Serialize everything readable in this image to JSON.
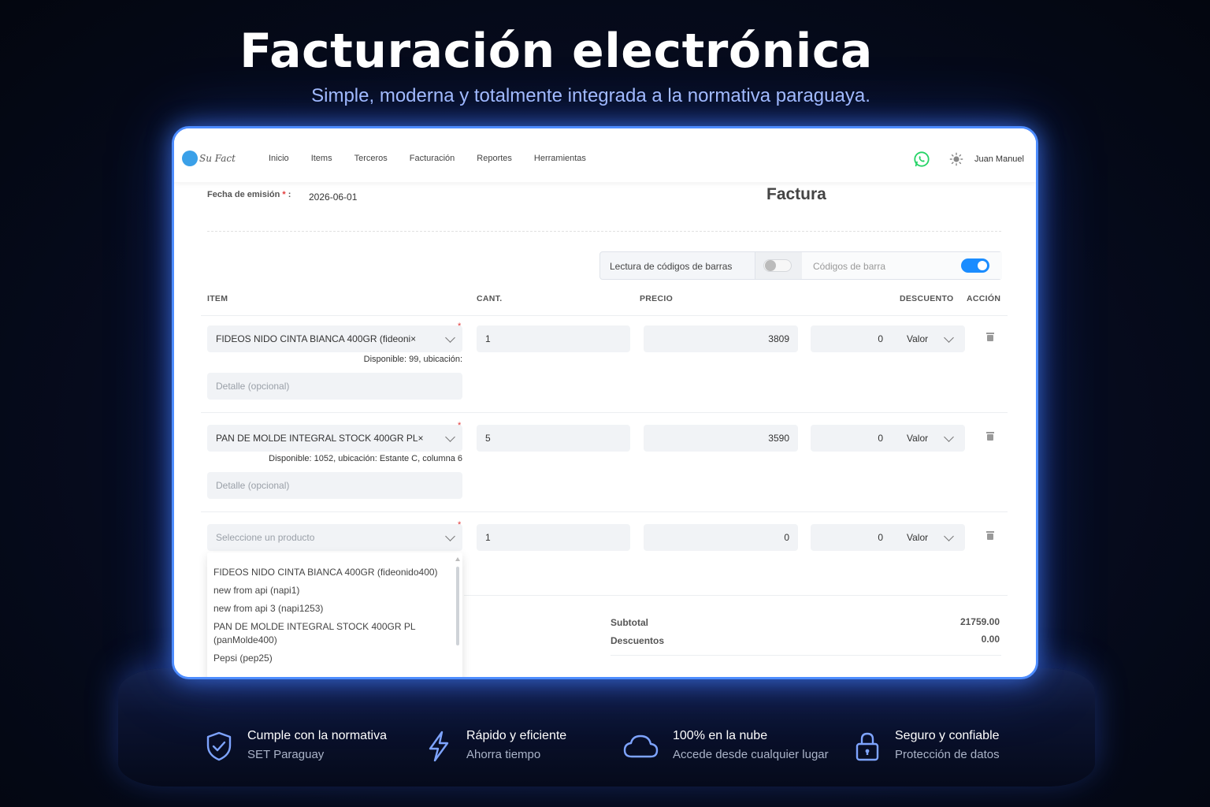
{
  "hero": {
    "title": "Facturación electrónica",
    "subtitle": "Simple, moderna y totalmente integrada a la normativa paraguaya."
  },
  "app": {
    "logo_text": "Su Fact",
    "nav": [
      "Inicio",
      "Items",
      "Terceros",
      "Facturación",
      "Reportes",
      "Herramientas"
    ],
    "user_name": "Juan Manuel",
    "fecha_label": "Fecha de emisión",
    "fecha_suffix": ":",
    "fecha_value": "2026-06-01",
    "page_title": "Factura",
    "barcode_reading_label": "Lectura de códigos de barras",
    "barcode_reading_on": false,
    "barcodes_label": "Códigos de barra",
    "barcodes_on": true,
    "columns": {
      "item": "ITEM",
      "cant": "CANT.",
      "precio": "PRECIO",
      "descuento": "DESCUENTO",
      "accion": "ACCIÓN"
    },
    "rows": [
      {
        "item": "FIDEOS NIDO CINTA BIANCA 400GR (fideoni×",
        "availability": "Disponible: 99, ubicación:",
        "detail_placeholder": "Detalle (opcional)",
        "cant": "1",
        "precio": "3809",
        "descuento": "0",
        "descuento_tipo": "Valor"
      },
      {
        "item": "PAN DE MOLDE INTEGRAL STOCK 400GR PL×",
        "availability": "Disponible: 1052, ubicación: Estante C, columna 6",
        "detail_placeholder": "Detalle (opcional)",
        "cant": "5",
        "precio": "3590",
        "descuento": "0",
        "descuento_tipo": "Valor"
      },
      {
        "item_placeholder": "Seleccione un producto",
        "cant": "1",
        "precio": "0",
        "descuento": "0",
        "descuento_tipo": "Valor"
      }
    ],
    "dropdown_options": [
      "FIDEOS NIDO CINTA BIANCA 400GR (fideonido400)",
      "new from api (napi1)",
      "new from api 3 (napi1253)",
      "PAN DE MOLDE INTEGRAL STOCK 400GR PL (panMolde400)",
      "Pepsi (pep25)"
    ],
    "totals": {
      "subtotal_label": "Subtotal",
      "subtotal_value": "21759.00",
      "descuentos_label": "Descuentos",
      "descuentos_value": "0.00"
    }
  },
  "features": [
    {
      "icon": "shield-check-icon",
      "title": "Cumple con la normativa",
      "subtitle": "SET Paraguay"
    },
    {
      "icon": "lightning-icon",
      "title": "Rápido y eficiente",
      "subtitle": "Ahorra tiempo"
    },
    {
      "icon": "cloud-icon",
      "title": "100% en la nube",
      "subtitle": "Accede desde cualquier lugar"
    },
    {
      "icon": "lock-icon",
      "title": "Seguro y confiable",
      "subtitle": "Protección de datos"
    }
  ],
  "colors": {
    "accent": "#4d8cff",
    "toggle_on": "#1a8cff",
    "whatsapp": "#25d366",
    "required": "#e23b3b"
  }
}
